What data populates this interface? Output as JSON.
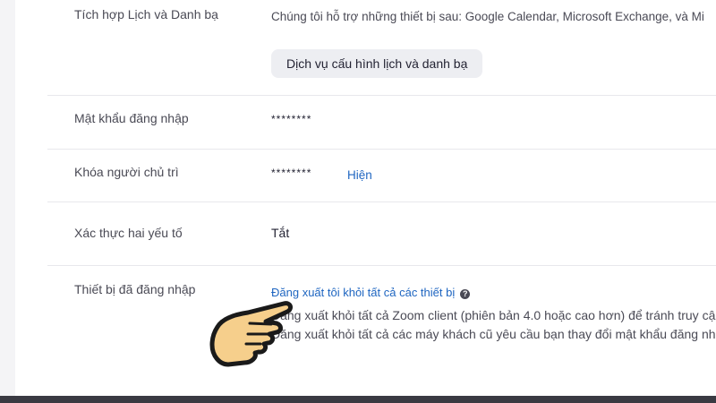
{
  "calendar": {
    "label": "Tích hợp Lịch và Danh bạ",
    "description": "Chúng tôi hỗ trợ những thiết bị sau: Google Calendar, Microsoft Exchange, và Mi",
    "button_label": "Dịch vụ cấu hình lịch và danh bạ"
  },
  "login_password": {
    "label": "Mật khẩu đăng nhập",
    "value": "********"
  },
  "host_key": {
    "label": "Khóa người chủ trì",
    "value": "********",
    "show_link": "Hiện"
  },
  "two_factor": {
    "label": "Xác thực hai yếu tố",
    "value": "Tắt"
  },
  "devices": {
    "label": "Thiết bị đã đăng nhập",
    "signout_link": "Đăng xuất tôi khỏi tất cả các thiết bị",
    "help_icon": "question-circle-icon",
    "bullet_1": "Đăng xuất khỏi tất cả Zoom client (phiên bản 4.0 hoặc cao hơn) để tránh truy cập",
    "bullet_2": "Đăng xuất khỏi tất cả các máy khách cũ yêu cầu bạn thay đổi mật khẩu đăng nhập"
  },
  "overlay": {
    "icon": "pointing-hand-icon",
    "color": "#f6cf8c"
  }
}
